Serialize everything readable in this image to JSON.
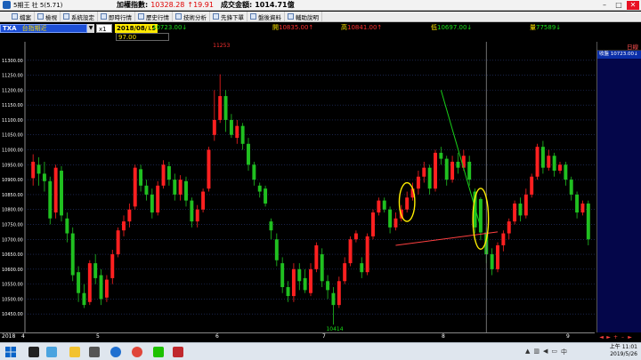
{
  "titlebar": {
    "app_title": "5期王 社 5(5.71)",
    "index_label": "加權指數:",
    "index_value": "10328.28",
    "index_change": "↑19.91",
    "amount_label": "成交金額:",
    "amount_value": "1014.71億"
  },
  "toolbar": {
    "items": [
      "檔案",
      "檢視",
      "系統設定",
      "即時行情",
      "歷史行情",
      "技術分析",
      "先鋒下單",
      "盤後資料",
      "輔助說明"
    ]
  },
  "quote": {
    "symbol": "TXA",
    "name": "台指期近",
    "multiplier": "x1",
    "date": "2018/08/15",
    "close_label": "收",
    "close_value": "10723.00↓",
    "open_label": "開",
    "open_value": "10835.00↑",
    "high_label": "高",
    "high_value": "10841.00↑",
    "low_label": "低",
    "low_value": "10697.00↓",
    "volume_label": "量",
    "volume_value": "77589↓",
    "sub_value": "97.00"
  },
  "right_panel": {
    "header": "日線",
    "row": "收盤 10723.00↓"
  },
  "colors": {
    "up": "#ff2020",
    "down": "#20c020",
    "grid": "#2a3a78",
    "bg": "#000000",
    "marker": "#ffee00",
    "trend_green": "#19d019",
    "trend_red": "#ff4040"
  },
  "chart_data": {
    "type": "candlestick",
    "ylim": [
      10400,
      11350
    ],
    "yticks": [
      10450,
      10500,
      10550,
      10600,
      10650,
      10700,
      10750,
      10800,
      10850,
      10900,
      10950,
      11000,
      11050,
      11100,
      11150,
      11200,
      11250,
      11300
    ],
    "high_label": "11253",
    "low_label": "10414",
    "month_label": "2018",
    "month_ticks": [
      "4",
      "5",
      "6",
      "7",
      "8",
      "9"
    ],
    "candles": [
      [
        10905,
        10960,
        10880,
        10985
      ],
      [
        10950,
        10920,
        10880,
        10975
      ],
      [
        10920,
        10895,
        10860,
        10960
      ],
      [
        10895,
        10770,
        10750,
        10910
      ],
      [
        10790,
        10940,
        10770,
        10950
      ],
      [
        10930,
        10780,
        10760,
        10945
      ],
      [
        10770,
        10720,
        10690,
        10790
      ],
      [
        10720,
        10580,
        10560,
        10740
      ],
      [
        10590,
        10520,
        10490,
        10610
      ],
      [
        10520,
        10480,
        10470,
        10550
      ],
      [
        10490,
        10620,
        10480,
        10630
      ],
      [
        10620,
        10570,
        10550,
        10650
      ],
      [
        10580,
        10500,
        10480,
        10600
      ],
      [
        10505,
        10565,
        10490,
        10580
      ],
      [
        10570,
        10650,
        10550,
        10665
      ],
      [
        10650,
        10730,
        10640,
        10740
      ],
      [
        10730,
        10760,
        10710,
        10780
      ],
      [
        10760,
        10800,
        10740,
        10820
      ],
      [
        10810,
        10940,
        10800,
        10950
      ],
      [
        10935,
        10880,
        10860,
        10950
      ],
      [
        10880,
        10850,
        10830,
        10900
      ],
      [
        10850,
        10790,
        10770,
        10870
      ],
      [
        10790,
        10880,
        10780,
        10895
      ],
      [
        10880,
        10950,
        10870,
        10965
      ],
      [
        10945,
        10900,
        10880,
        10960
      ],
      [
        10900,
        10850,
        10830,
        10920
      ],
      [
        10850,
        10900,
        10830,
        10915
      ],
      [
        10895,
        10830,
        10810,
        10910
      ],
      [
        10830,
        10760,
        10740,
        10840
      ],
      [
        10760,
        10800,
        10740,
        10815
      ],
      [
        10800,
        10860,
        10790,
        10870
      ],
      [
        10870,
        11000,
        10860,
        11010
      ],
      [
        11050,
        11100,
        11030,
        11200
      ],
      [
        11100,
        11180,
        11090,
        11253
      ],
      [
        11180,
        11100,
        11060,
        11200
      ],
      [
        11100,
        11050,
        11040,
        11120
      ],
      [
        11040,
        11080,
        11020,
        11100
      ],
      [
        11080,
        11020,
        11000,
        11090
      ],
      [
        11020,
        10950,
        10930,
        11040
      ],
      [
        10950,
        10900,
        10880,
        10960
      ],
      [
        10880,
        10860,
        10840,
        10890
      ],
      [
        10870,
        10820,
        10810,
        10880
      ],
      [
        10760,
        10730,
        10700,
        10770
      ],
      [
        10700,
        10630,
        10610,
        10720
      ],
      [
        10620,
        10540,
        10520,
        10640
      ],
      [
        10540,
        10510,
        10490,
        10560
      ],
      [
        10510,
        10600,
        10490,
        10620
      ],
      [
        10600,
        10560,
        10530,
        10620
      ],
      [
        10570,
        10530,
        10520,
        10600
      ],
      [
        10520,
        10600,
        10510,
        10620
      ],
      [
        10600,
        10680,
        10590,
        10690
      ],
      [
        10650,
        10560,
        10540,
        10670
      ],
      [
        10560,
        10530,
        10500,
        10580
      ],
      [
        10520,
        10480,
        10414,
        10540
      ],
      [
        10480,
        10560,
        10470,
        10575
      ],
      [
        10560,
        10620,
        10550,
        10640
      ],
      [
        10620,
        10700,
        10610,
        10710
      ],
      [
        10700,
        10720,
        10690,
        10730
      ],
      [
        10620,
        10590,
        10570,
        10640
      ],
      [
        10590,
        10710,
        10580,
        10720
      ],
      [
        10710,
        10790,
        10700,
        10800
      ],
      [
        10790,
        10830,
        10780,
        10840
      ],
      [
        10830,
        10800,
        10790,
        10840
      ],
      [
        10800,
        10740,
        10720,
        10810
      ],
      [
        10740,
        10770,
        10730,
        10790
      ],
      [
        10770,
        10800,
        10760,
        10815
      ],
      [
        10800,
        10840,
        10790,
        10860
      ],
      [
        10840,
        10870,
        10830,
        10890
      ],
      [
        10870,
        10910,
        10850,
        10930
      ],
      [
        10910,
        10940,
        10890,
        10960
      ],
      [
        10940,
        10870,
        10850,
        10950
      ],
      [
        10870,
        10990,
        10860,
        11000
      ],
      [
        10990,
        10970,
        10950,
        11010
      ],
      [
        10970,
        10900,
        10880,
        10980
      ],
      [
        10900,
        10960,
        10890,
        10980
      ],
      [
        10960,
        10940,
        10920,
        10990
      ],
      [
        10940,
        10980,
        10930,
        11000
      ],
      [
        10960,
        10900,
        10880,
        10980
      ],
      [
        10860,
        10740,
        10720,
        10870
      ],
      [
        10835,
        10723,
        10697,
        10841
      ],
      [
        10723,
        10650,
        10620,
        10740
      ],
      [
        10650,
        10600,
        10580,
        10670
      ],
      [
        10600,
        10680,
        10590,
        10690
      ],
      [
        10680,
        10720,
        10660,
        10730
      ],
      [
        10720,
        10760,
        10700,
        10770
      ],
      [
        10760,
        10820,
        10750,
        10830
      ],
      [
        10820,
        10780,
        10760,
        10840
      ],
      [
        10780,
        10850,
        10770,
        10870
      ],
      [
        10850,
        10910,
        10840,
        10920
      ],
      [
        10910,
        11010,
        10900,
        11020
      ],
      [
        11010,
        10940,
        10920,
        11030
      ],
      [
        10940,
        10980,
        10930,
        11000
      ],
      [
        10980,
        10930,
        10910,
        10990
      ],
      [
        10930,
        10950,
        10920,
        10960
      ],
      [
        10950,
        10900,
        10880,
        10960
      ],
      [
        10900,
        10850,
        10830,
        10910
      ],
      [
        10850,
        10790,
        10770,
        10860
      ],
      [
        10790,
        10820,
        10780,
        10830
      ],
      [
        10820,
        10700,
        10680,
        10830
      ]
    ],
    "marker_ellipses": [
      {
        "index": 66
      },
      {
        "index": 79
      }
    ],
    "trend_green": {
      "from_index": 72,
      "from_value": 11200,
      "to_index": 79,
      "to_value": 10740
    },
    "trend_red": {
      "from_index": 64,
      "from_value": 10680,
      "to_index": 82,
      "to_value": 10725
    },
    "cursor_index": 80
  },
  "date_axis": {
    "labels": [
      "2018",
      "4",
      "5",
      "6",
      "7",
      "8",
      "9"
    ]
  },
  "taskbar": {
    "time": "上午 11:01",
    "date": "2019/5/26"
  }
}
